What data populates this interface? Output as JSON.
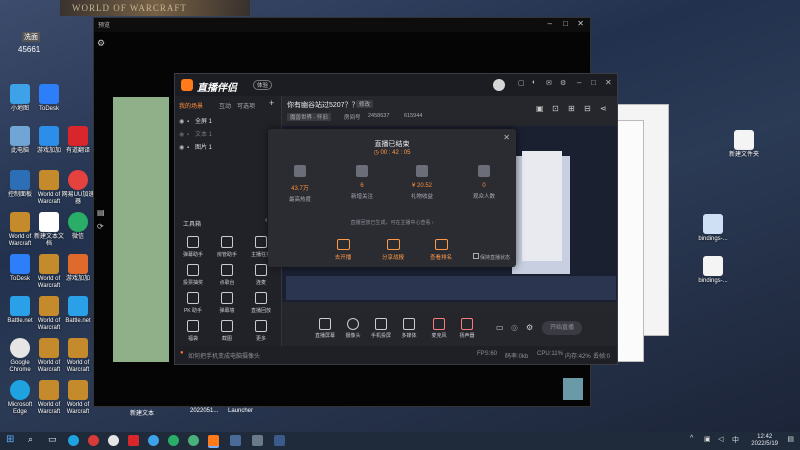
{
  "desktop": {
    "banner": "WORLD OF WARCRAFT",
    "fragments": [
      "45661",
      "洗面"
    ],
    "icons": [
      {
        "label": "小地图",
        "color": "#3da2e8"
      },
      {
        "label": "此电脑",
        "color": "#6fa6d6"
      },
      {
        "label": "控制面板",
        "color": "#2d6fb7"
      },
      {
        "label": "World of Warcraft",
        "color": "#c48a2c"
      },
      {
        "label": "ToDesk",
        "color": "#2d7ff9"
      },
      {
        "label": "Google Chrome",
        "color": "#e5e5e5"
      },
      {
        "label": "Microsoft Edge",
        "color": "#1fa3e0"
      },
      {
        "label": "网易云音乐",
        "color": "#d83a3a"
      },
      {
        "label": "微信",
        "color": "#2aae67"
      },
      {
        "label": "游戏加加",
        "color": "#2c8ee8"
      },
      {
        "label": "新建文本文档",
        "color": "#ffffff"
      },
      {
        "label": "有道翻译",
        "color": "#d9262c"
      },
      {
        "label": "网易UU加速器",
        "color": "#e5413e"
      },
      {
        "label": "Battle.net",
        "color": "#2aa0e8"
      },
      {
        "label": "新建文件夹",
        "color": "#e8c35a"
      },
      {
        "label": "bindings-...",
        "color": "#f4f4f4"
      },
      {
        "label": "bindings-...",
        "color": "#f4f4f4"
      }
    ],
    "taskbar_labels": [
      "新建文本",
      "2022051...",
      "Launcher"
    ]
  },
  "clock": {
    "time": "12:42",
    "date": "2022/5/19"
  },
  "black_window": {
    "title": "预览"
  },
  "app": {
    "brand": "直播伴侣",
    "badge": "体验",
    "stream_title": "你有幽谷站过5207？？",
    "edit_label": "修改",
    "category": "魔兽世界 · 怀旧",
    "room_label": "房间号",
    "room_id": "2458637",
    "fans": "615944",
    "left_tabs": [
      "我的场景",
      "互动",
      "可选项"
    ],
    "scenes": [
      {
        "name": "全屏 1"
      },
      {
        "name": "文本 1"
      },
      {
        "name": "图片 1"
      }
    ],
    "tools_title": "工具箱",
    "tools": [
      {
        "label": "弹幕助手"
      },
      {
        "label": "房管助手"
      },
      {
        "label": "主播任务"
      },
      {
        "label": "投票抽奖"
      },
      {
        "label": "点歌台"
      },
      {
        "label": "连麦"
      },
      {
        "label": "PK 助手"
      },
      {
        "label": "弹幕墙"
      },
      {
        "label": "直播回放"
      },
      {
        "label": "福袋"
      },
      {
        "label": "截图"
      },
      {
        "label": "更多"
      }
    ],
    "modal": {
      "title": "直播已结束",
      "duration": "00 : 42 : 05",
      "stats": [
        {
          "value": "43.7万",
          "label": "最高热度"
        },
        {
          "value": "6",
          "label": "新增关注"
        },
        {
          "value": "¥ 20.52",
          "label": "礼物收益"
        },
        {
          "value": "0",
          "label": "观众人数"
        }
      ],
      "note": "直播回放已生成，可在主播中心查看 ›",
      "actions": [
        {
          "label": "去开播"
        },
        {
          "label": "分享战报"
        },
        {
          "label": "查看排名"
        }
      ],
      "keep_label": "保持直播状态"
    },
    "bottom_buttons": [
      {
        "label": "直播屏幕"
      },
      {
        "label": "摄像头"
      },
      {
        "label": "手机投屏"
      },
      {
        "label": "多媒体"
      },
      {
        "label": "麦克风"
      },
      {
        "label": "扬声器"
      }
    ],
    "go_live": "开始直播",
    "status_tip": "如何把手机变成电脑摄像头",
    "status_items": [
      "FPS:60",
      "码率:0kb",
      "CPU:11%",
      "内存:42%",
      "丢帧:0"
    ]
  }
}
